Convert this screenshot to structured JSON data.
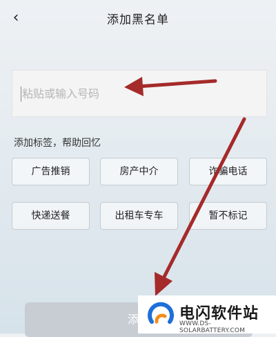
{
  "header": {
    "back_icon": "chevron-left-icon",
    "back_glyph": "‹",
    "title": "添加黑名单"
  },
  "input": {
    "placeholder": "粘贴或输入号码",
    "value": ""
  },
  "tags": {
    "hint": "添加标签，帮助回忆",
    "items": [
      {
        "label": "广告推销"
      },
      {
        "label": "房产中介"
      },
      {
        "label": "诈骗电话"
      },
      {
        "label": "快递送餐"
      },
      {
        "label": "出租车专车"
      },
      {
        "label": "暂不标记"
      }
    ]
  },
  "confirm": {
    "label": "添加"
  },
  "watermark": {
    "name": "电闪软件站",
    "url": "WWW.DS-SOLARBATTERY.COM"
  },
  "colors": {
    "annotation_arrow": "#a52a2a",
    "confirm_bg": "#c7cdd3",
    "tag_border": "#c5cbd1",
    "logo_blue": "#1e6fd9",
    "logo_orange": "#f28c1b"
  }
}
